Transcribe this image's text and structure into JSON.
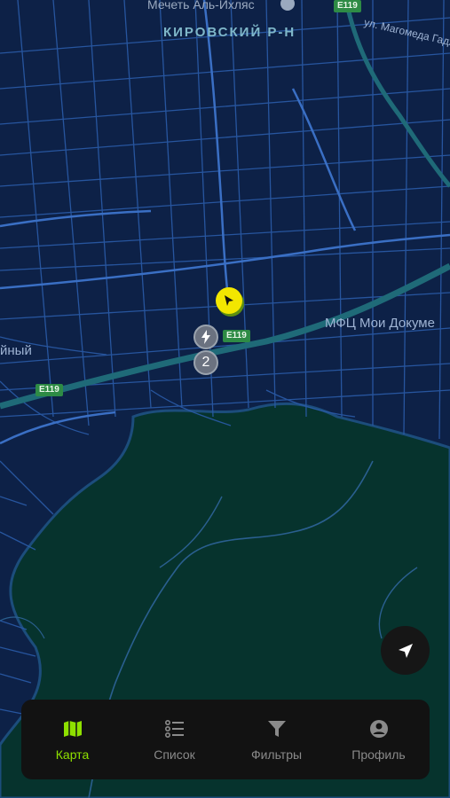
{
  "map": {
    "district_label": "КИРОВСКИЙ Р-Н",
    "poi_label": "Мечеть Аль-Ихляс",
    "street_label": "ул. Магомеда Гадж",
    "mfc_label": "МФЦ Мои Докуме",
    "place_partial_label": "йный",
    "highway_labels": [
      "E119",
      "E119",
      "E119"
    ],
    "cluster_count": "2",
    "colors": {
      "water": "#0d2147",
      "roads": "#2a5ba8",
      "highway": "#1f6a78",
      "forest": "#06332d",
      "accent": "#8ee000",
      "user_marker": "#f2e600"
    }
  },
  "markers": {
    "user_icon": "navigation-arrow-icon",
    "charger_icon": "lightning-icon",
    "locate_icon": "locate-arrow-icon"
  },
  "tabbar": {
    "tabs": [
      {
        "label": "Карта",
        "icon": "map-icon",
        "active": true
      },
      {
        "label": "Список",
        "icon": "list-icon",
        "active": false
      },
      {
        "label": "Фильтры",
        "icon": "filter-icon",
        "active": false
      },
      {
        "label": "Профиль",
        "icon": "profile-icon",
        "active": false
      }
    ]
  }
}
